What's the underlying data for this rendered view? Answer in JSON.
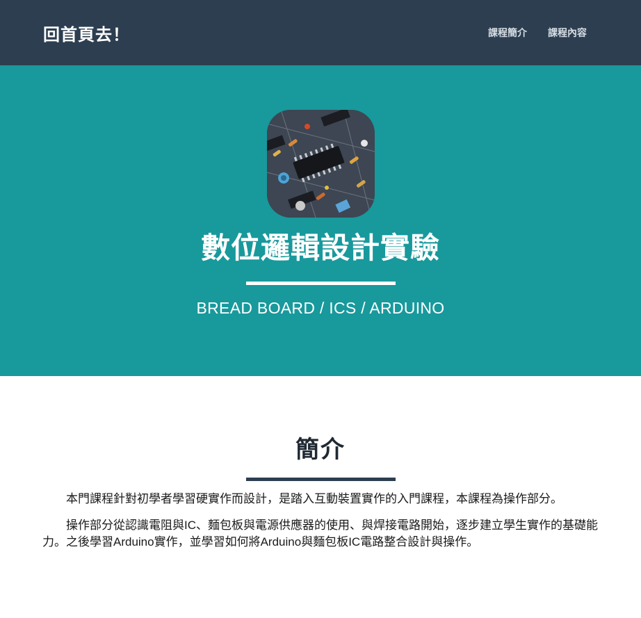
{
  "navbar": {
    "brand": "回首頁去！",
    "links": [
      {
        "label": "課程簡介"
      },
      {
        "label": "課程內容"
      }
    ]
  },
  "hero": {
    "image_icon": "circuit-board-photo",
    "title": "數位邏輯設計實驗",
    "subtitle": "BREAD BOARD / ICS / ARDUINO"
  },
  "about": {
    "title": "簡介",
    "paragraphs": [
      "本門課程針對初學者學習硬實作而設計，是踏入互動裝置實作的入門課程，本課程為操作部分。",
      "操作部分從認識電阻與IC、麵包板與電源供應器的使用、與焊接電路開始，逐步建立學生實作的基礎能力。之後學習Arduino實作，並學習如何將Arduino與麵包板IC電路整合設計與操作。"
    ]
  },
  "colors": {
    "navbar": "#2c3e50",
    "hero": "#18999c",
    "white": "#ffffff"
  }
}
